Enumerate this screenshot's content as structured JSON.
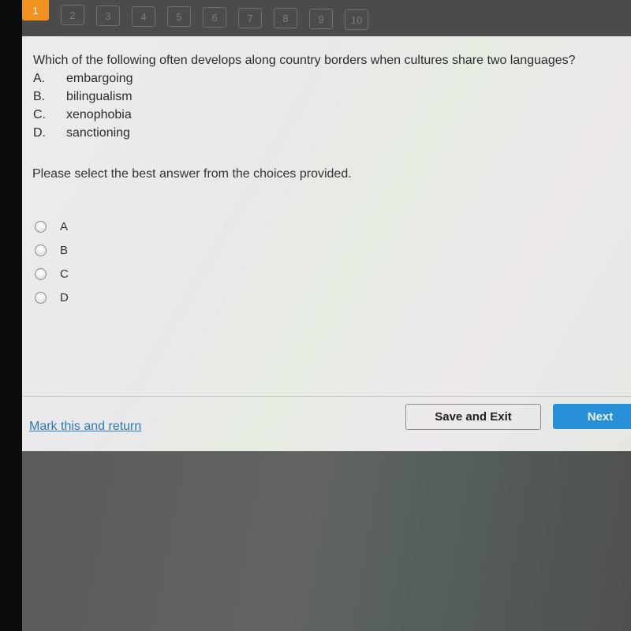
{
  "question_nav": {
    "items": [
      "1",
      "2",
      "3",
      "4",
      "5",
      "6",
      "7",
      "8",
      "9",
      "10"
    ],
    "active_index": 0,
    "active_color": "#f0921e"
  },
  "question": {
    "stem": "Which of the following often develops along country borders when cultures share two languages?",
    "choices": [
      {
        "letter": "A.",
        "text": "embargoing"
      },
      {
        "letter": "B.",
        "text": "bilingualism"
      },
      {
        "letter": "C.",
        "text": "xenophobia"
      },
      {
        "letter": "D.",
        "text": "sanctioning"
      }
    ]
  },
  "instruction": "Please select the best answer from the choices provided.",
  "answer_options": [
    {
      "label": "A",
      "selected": false
    },
    {
      "label": "B",
      "selected": false
    },
    {
      "label": "C",
      "selected": false
    },
    {
      "label": "D",
      "selected": false
    }
  ],
  "footer": {
    "mark_link": "Mark this and return",
    "save_exit_label": "Save and Exit",
    "next_label": "Next",
    "next_color": "#2790d8",
    "link_color": "#2d7bb6"
  }
}
